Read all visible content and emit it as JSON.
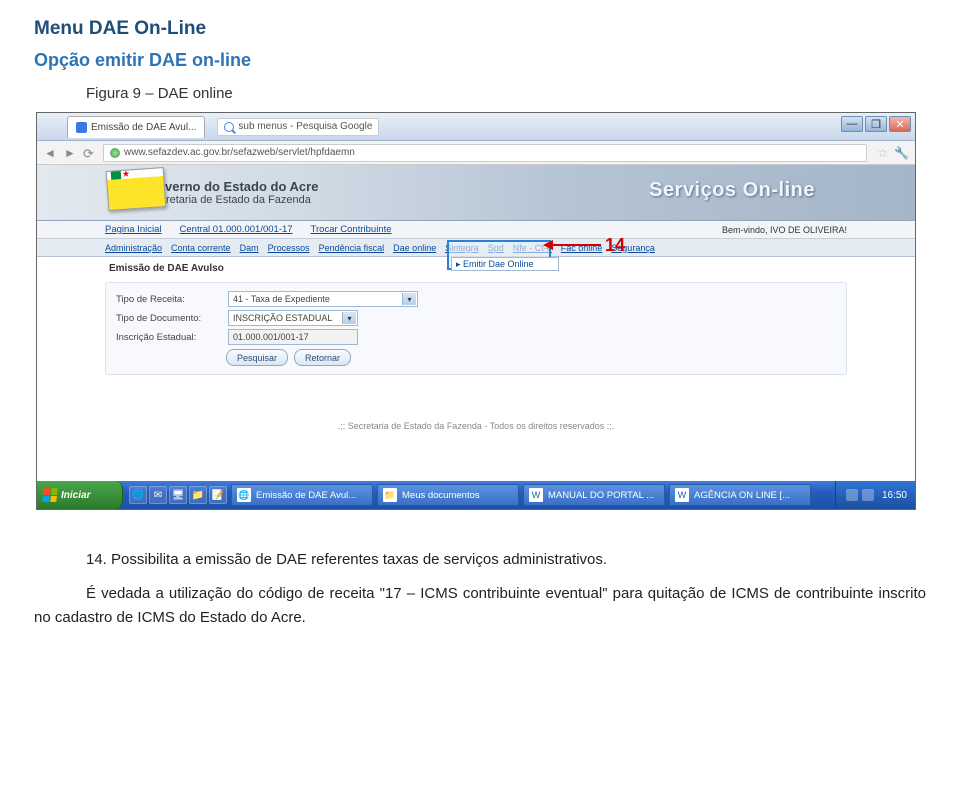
{
  "document": {
    "heading1": "Menu DAE On-Line",
    "heading2": "Opção emitir DAE on-line",
    "caption": "Figura 9 – DAE online",
    "para1": "14. Possibilita a emissão de DAE referentes taxas de serviços administrativos.",
    "para2": "É vedada a utilização do código de receita \"17 – ICMS contribuinte eventual\" para quitação de ICMS de contribuinte inscrito no cadastro de ICMS do Estado do Acre."
  },
  "browser": {
    "tab_title": "Emissão de DAE Avul...",
    "google_box": "sub menus - Pesquisa Google",
    "url": "www.sefazdev.ac.gov.br/sefazweb/servlet/hpfdaemn",
    "win_min": "—",
    "win_max": "❐",
    "win_close": "✕"
  },
  "page": {
    "gov_line1": "Governo do Estado do Acre",
    "gov_line2": "Secretaria de Estado da Fazenda",
    "servicos": "Serviços On-line",
    "menu1": {
      "items": [
        "Pagina Inicial",
        "Central 01.000.001/001-17",
        "Trocar Contribuinte"
      ],
      "welcome": "Bem-vindo, IVO DE OLIVEIRA!"
    },
    "menu2": [
      "Administração",
      "Conta corrente",
      "Dam",
      "Processos",
      "Pendência fiscal",
      "Dae online",
      "Sintegra",
      "Spd",
      "Nfe - Ct-e",
      "Fac online",
      "Segurança"
    ],
    "submenu_item": "▸ Emitir Dae Online",
    "callout": "14",
    "section_title": "Emissão de DAE Avulso",
    "form": {
      "labels": {
        "tipo_receita": "Tipo de Receita:",
        "tipo_documento": "Tipo de Documento:",
        "inscricao": "Inscrição Estadual:"
      },
      "values": {
        "tipo_receita": "41 - Taxa de Expediente",
        "tipo_documento": "INSCRIÇÃO ESTADUAL",
        "inscricao": "01.000.001/001-17"
      },
      "buttons": {
        "pesquisar": "Pesquisar",
        "retornar": "Retornar"
      }
    },
    "footer": ".:: Secretaria de Estado da Fazenda - Todos os direitos reservados ::."
  },
  "taskbar": {
    "start": "Iniciar",
    "tasks": [
      {
        "icon": "🌐",
        "label": "Emissão de DAE Avul..."
      },
      {
        "icon": "📁",
        "label": "Meus documentos"
      },
      {
        "icon": "W",
        "label": "MANUAL DO PORTAL ..."
      },
      {
        "icon": "W",
        "label": "AGÊNCIA ON LINE [..."
      }
    ],
    "clock": "16:50"
  }
}
